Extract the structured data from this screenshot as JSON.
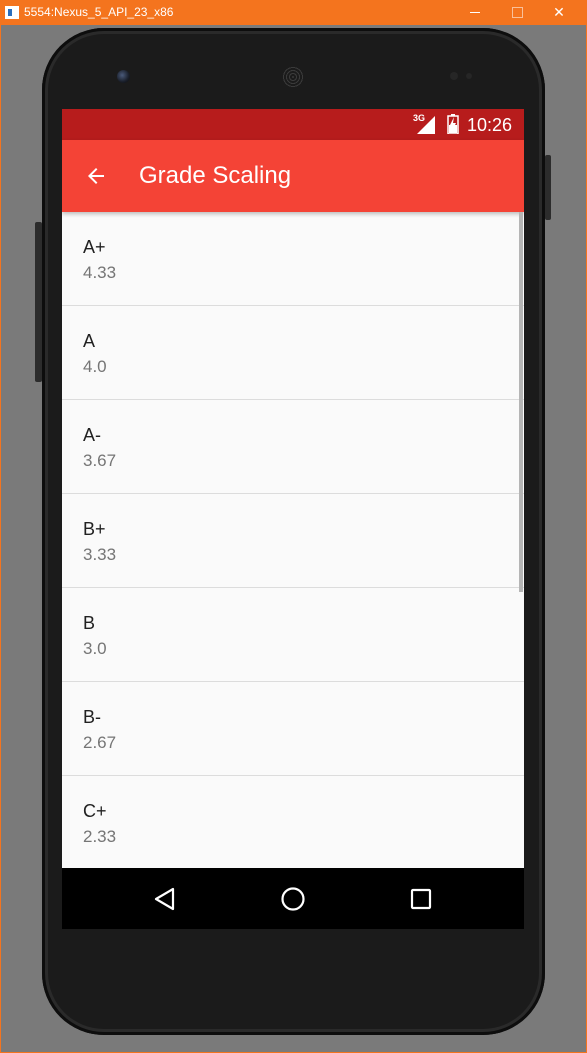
{
  "window": {
    "title": "5554:Nexus_5_API_23_x86",
    "icons": [
      "emulator-app-icon",
      "minimize-icon",
      "maximize-icon",
      "close-icon"
    ],
    "close_glyph": "✕"
  },
  "statusbar": {
    "network": "3G",
    "time": "10:26",
    "icons": [
      "signal-icon",
      "battery-icon"
    ]
  },
  "appbar": {
    "title": "Grade Scaling",
    "back_icon": "arrow-back-icon"
  },
  "grades": [
    {
      "grade": "A+",
      "value": "4.33"
    },
    {
      "grade": "A",
      "value": "4.0"
    },
    {
      "grade": "A-",
      "value": "3.67"
    },
    {
      "grade": "B+",
      "value": "3.33"
    },
    {
      "grade": "B",
      "value": "3.0"
    },
    {
      "grade": "B-",
      "value": "2.67"
    },
    {
      "grade": "C+",
      "value": "2.33"
    }
  ],
  "navbar": {
    "icons": [
      "nav-back-icon",
      "nav-home-icon",
      "nav-recents-icon"
    ]
  },
  "colors": {
    "statusbar": "#b71c1c",
    "appbar": "#f44336",
    "window_frame": "#f4741e",
    "list_background": "#fafafa",
    "primary_text": "#212121",
    "secondary_text": "#757575"
  }
}
